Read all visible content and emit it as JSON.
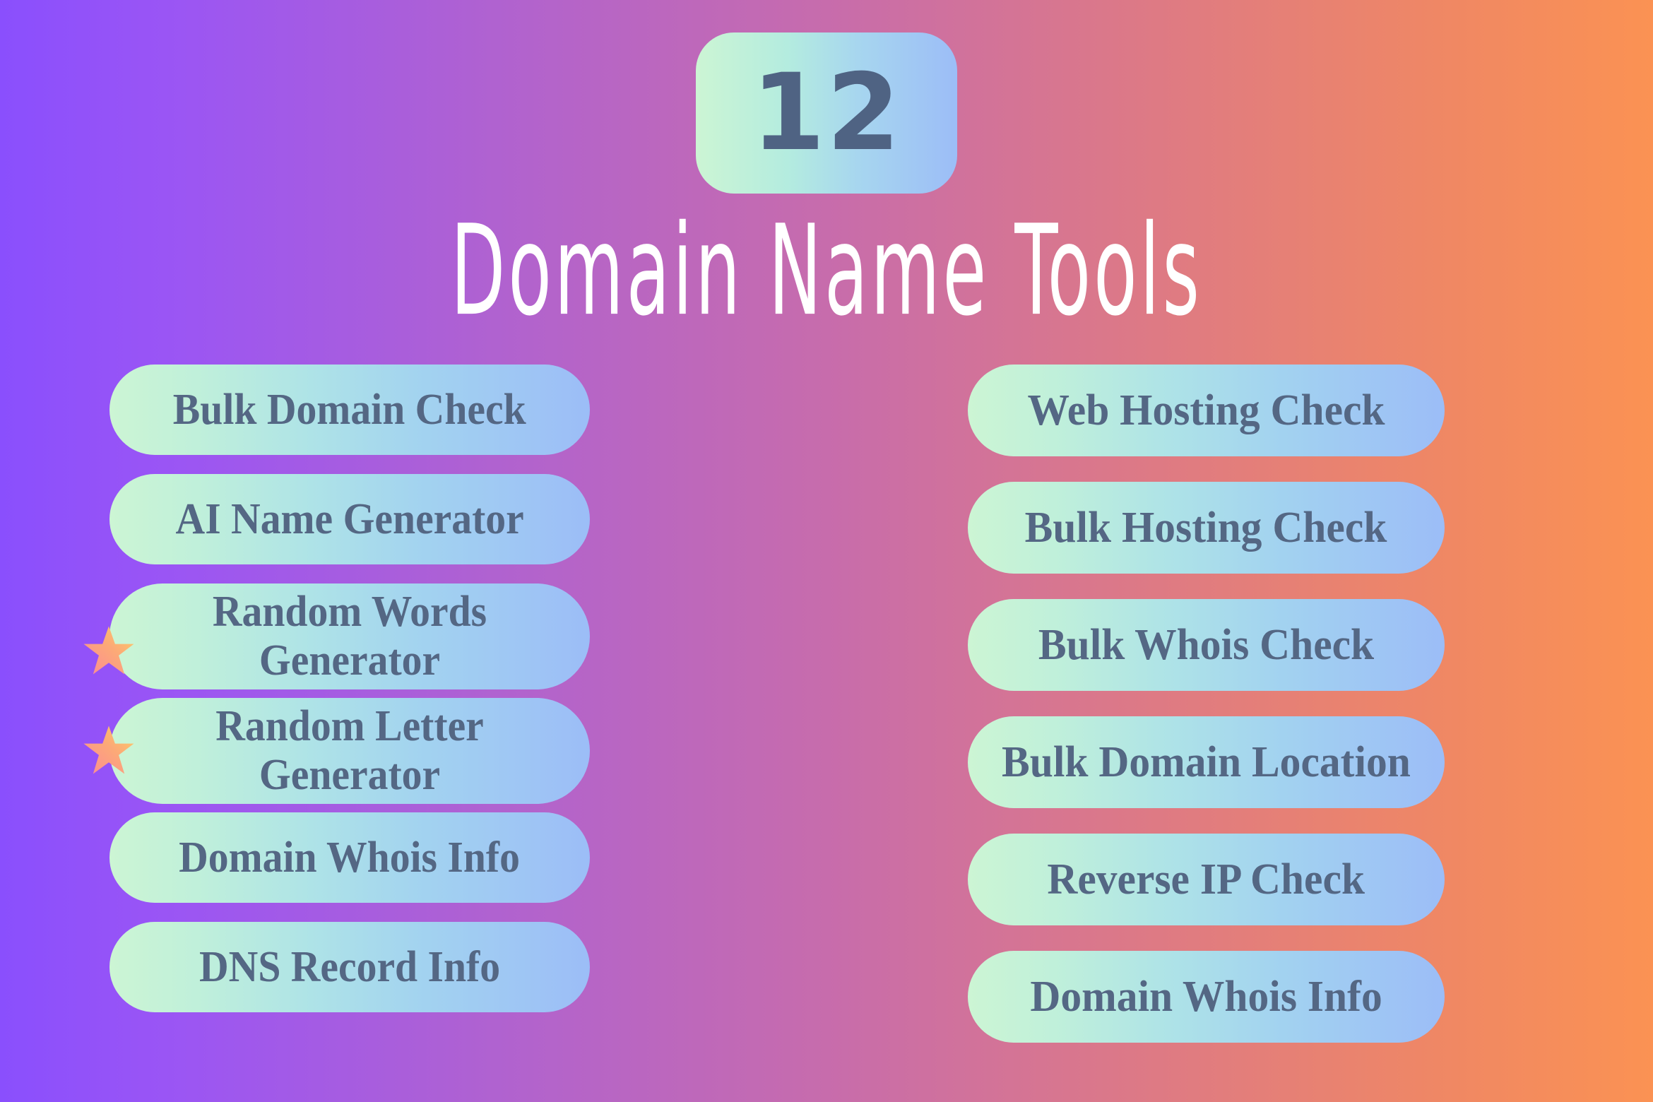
{
  "header": {
    "count_badge": "12",
    "title": "Domain Name Tools"
  },
  "colors": {
    "background_start": "#8a4ffd",
    "background_mid": "#c76cac",
    "background_end": "#fb9253",
    "pill_gradient_start": "#ccf5d4",
    "pill_gradient_end": "#9cbdf7",
    "pill_text": "#546784",
    "badge_text": "#4f6383",
    "title_text": "#ffffff",
    "star_gradient_start": "#fb8a96",
    "star_gradient_end": "#fdd166"
  },
  "columns": {
    "left": [
      {
        "label": "Bulk Domain Check",
        "two_line": false,
        "starred": false
      },
      {
        "label": "AI Name Generator",
        "two_line": false,
        "starred": false
      },
      {
        "label": "Random Words Generator",
        "two_line": true,
        "starred": true
      },
      {
        "label": "Random Letter Generator",
        "two_line": true,
        "starred": true
      },
      {
        "label": "Domain Whois Info",
        "two_line": false,
        "starred": false
      },
      {
        "label": "DNS Record Info",
        "two_line": false,
        "starred": false
      }
    ],
    "right": [
      {
        "label": "Web Hosting Check",
        "two_line": false,
        "starred": false
      },
      {
        "label": "Bulk Hosting Check",
        "two_line": false,
        "starred": false
      },
      {
        "label": "Bulk Whois Check",
        "two_line": false,
        "starred": false
      },
      {
        "label": "Bulk Domain Location",
        "two_line": false,
        "starred": false
      },
      {
        "label": "Reverse IP Check",
        "two_line": false,
        "starred": false
      },
      {
        "label": "Domain Whois Info",
        "two_line": false,
        "starred": false
      }
    ]
  }
}
